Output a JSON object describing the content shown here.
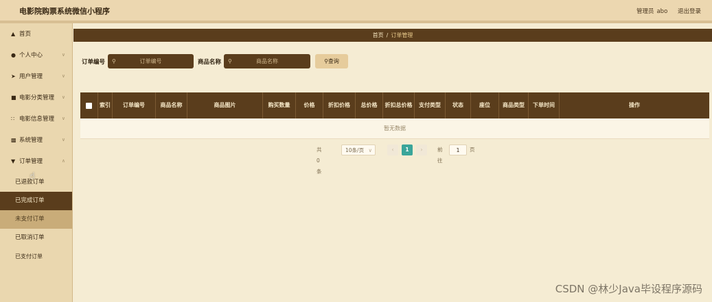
{
  "header": {
    "title": "电影院购票系统微信小程序",
    "role_label": "管理员",
    "username": "abo",
    "logout_label": "退出登录"
  },
  "sidebar": {
    "items": [
      {
        "label": "首页",
        "icon": "home-icon"
      },
      {
        "label": "个人中心",
        "icon": "user-icon"
      },
      {
        "label": "用户管理",
        "icon": "send-icon"
      },
      {
        "label": "电影分类管理",
        "icon": "list-icon"
      },
      {
        "label": "电影信息管理",
        "icon": "grid-icon"
      },
      {
        "label": "系统管理",
        "icon": "chart-icon"
      },
      {
        "label": "订单管理",
        "icon": "cup-icon"
      }
    ],
    "order_sub_items": [
      "已退款订单",
      "已完成订单",
      "未支付订单",
      "已取消订单",
      "已支付订单"
    ]
  },
  "breadcrumb": {
    "home": "首页",
    "separator": "/",
    "current": "订单管理"
  },
  "search": {
    "order_no_label": "订单编号",
    "order_no_placeholder": "订单编号",
    "product_name_label": "商品名称",
    "product_name_placeholder": "商品名称",
    "query_label": "查询"
  },
  "table": {
    "columns": [
      "索引",
      "订单编号",
      "商品名称",
      "商品图片",
      "购买数量",
      "价格",
      "折扣价格",
      "总价格",
      "折扣总价格",
      "支付类型",
      "状态",
      "座位",
      "商品类型",
      "下单时间",
      "操作"
    ],
    "empty_text": "暂无数据"
  },
  "pagination": {
    "total_text": "共 0 条",
    "page_size": "10条/页",
    "current_page": "1",
    "goto_label": "前往",
    "goto_value": "1",
    "page_suffix": "页"
  },
  "watermark": "CSDN @林少Java毕设程序源码",
  "colors": {
    "brand_dark": "#5a3d1c",
    "background": "#f5ecd3",
    "sidebar": "#ead7af",
    "pager_active": "#3aa59a"
  }
}
